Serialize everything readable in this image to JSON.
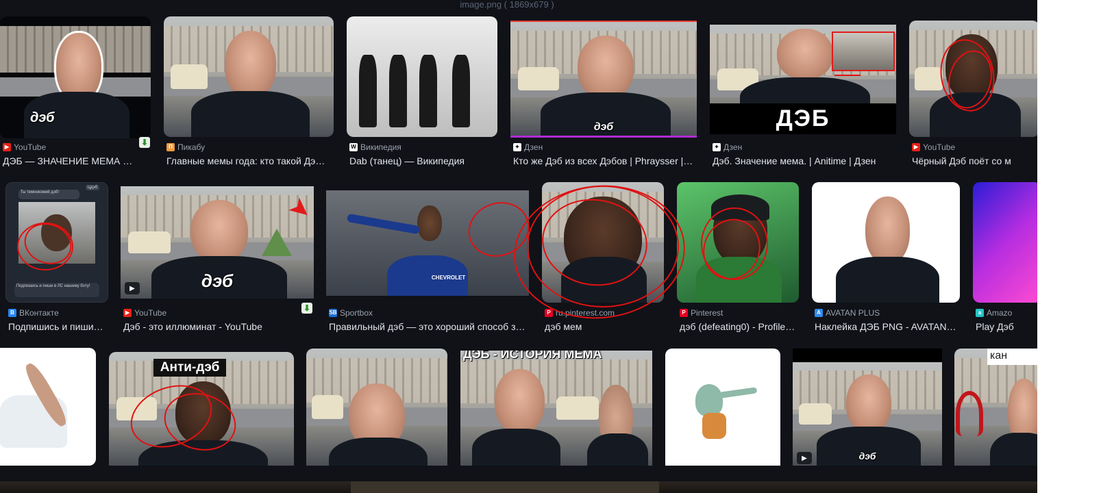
{
  "file_caption": "image.png ( 1869x679 )",
  "colors": {
    "panel": "#101218",
    "youtube": "#e62117",
    "vk": "#2787f5",
    "pinterest": "#e60023",
    "dzen": "#ffffff",
    "pikabu": "#f19a3e",
    "wiki": "#ffffff",
    "sportbox": "#1f6fd1",
    "avatan": "#2d8cf0"
  },
  "row1": [
    {
      "source": "YouTube",
      "icon": "youtube-icon",
      "title": "ДЭБ — ЗНАЧЕНИЕ МЕМА …",
      "overlay": "дэб"
    },
    {
      "source": "Пикабу",
      "icon": "pikabu-icon",
      "title": "Главные мемы года: кто такой Дэ…"
    },
    {
      "source": "Википедия",
      "icon": "wikipedia-icon",
      "title": "Dab (танец) — Википедия"
    },
    {
      "source": "Дзен",
      "icon": "dzen-icon",
      "title": "Кто же Дэб из всех Дэбов | Phrаysser |…",
      "overlay": "дэб"
    },
    {
      "source": "Дзен",
      "icon": "dzen-icon",
      "title": "Дэб. Значение мема. | Anitime | Дзен",
      "overlay": "ДЭБ"
    },
    {
      "source": "YouTube",
      "icon": "youtube-icon",
      "title": "Чёрный Дэб поёт со м"
    }
  ],
  "row2": [
    {
      "source": "ВКонтакте",
      "icon": "vk-icon",
      "title": "Подпишись и пиши…",
      "vk_bubble": "Ты темнокожий дэб!",
      "vk_input": "Подпишись и пиши в ЛС нашему боту!",
      "vk_tag": "Цдэб"
    },
    {
      "source": "YouTube",
      "icon": "youtube-icon",
      "title": "Дэб - это иллюминат - YouTube",
      "overlay": "дэб"
    },
    {
      "source": "Sportbox",
      "icon": "sportbox-icon",
      "title": "Правильный дэб — это хороший способ з…",
      "overlay": "CHEVROLET"
    },
    {
      "source": "ru.pinterest.com",
      "icon": "pinterest-icon",
      "title": "дэб мем"
    },
    {
      "source": "Pinterest",
      "icon": "pinterest-icon",
      "title": "дэб (defeating0) - Profile…"
    },
    {
      "source": "AVATAN PLUS",
      "icon": "avatan-icon",
      "title": "Наклейка ДЭБ PNG - AVATAN…"
    },
    {
      "source": "Amazo",
      "icon": "amazon-icon",
      "title": "Play Дэб"
    }
  ],
  "row3": [
    {
      "overlay": ""
    },
    {
      "overlay": "Анти-дэб"
    },
    {
      "overlay": ""
    },
    {
      "overlay": "ДЭБ - ИСТОРИЯ МЕМА"
    },
    {
      "overlay": ""
    },
    {
      "overlay": "дэб"
    },
    {
      "overlay": "кан"
    }
  ]
}
